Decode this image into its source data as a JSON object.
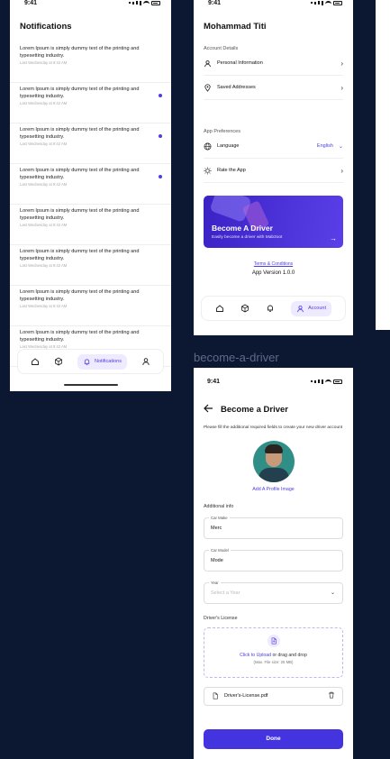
{
  "status_time": "9:41",
  "notifications": {
    "title": "Notifications",
    "items": [
      {
        "text": "Lorem Ipsum is simply dummy text of the printing and typesetting industry.",
        "time": "Last Wednesday at 9:42 AM",
        "unread": false
      },
      {
        "text": "Lorem Ipsum is simply dummy text of the printing and typesetting industry.",
        "time": "Last Wednesday at 9:42 AM",
        "unread": true
      },
      {
        "text": "Lorem Ipsum is simply dummy text of the printing and typesetting industry.",
        "time": "Last Wednesday at 9:42 AM",
        "unread": true
      },
      {
        "text": "Lorem Ipsum is simply dummy text of the printing and typesetting industry.",
        "time": "Last Wednesday at 9:42 AM",
        "unread": true
      },
      {
        "text": "Lorem Ipsum is simply dummy text of the printing and typesetting industry.",
        "time": "Last Wednesday at 9:42 AM",
        "unread": false
      },
      {
        "text": "Lorem Ipsum is simply dummy text of the printing and typesetting industry.",
        "time": "Last Wednesday at 9:42 AM",
        "unread": false
      },
      {
        "text": "Lorem Ipsum is simply dummy text of the printing and typesetting industry.",
        "time": "Last Wednesday at 9:42 AM",
        "unread": false
      },
      {
        "text": "Lorem Ipsum is simply dummy text of the printing and typesetting industry.",
        "time": "Last Wednesday at 9:42 AM",
        "unread": false
      }
    ],
    "nav_active_label": "Notifications"
  },
  "account": {
    "title": "Mohammad Titi",
    "account_details_label": "Account Details",
    "personal_info": "Personal Information",
    "saved_addresses": "Saved Addresses",
    "app_prefs_label": "App Preferences",
    "language": "Language",
    "language_value": "English",
    "rate_app": "Rate the App",
    "driver_card_title": "Become A Driver",
    "driver_card_sub": "Easily become a driver with Mab3oot",
    "terms": "Terms & Conditions",
    "version": "App Version 1.0.0",
    "nav_active_label": "Account"
  },
  "section_label": "become-a-driver",
  "driver": {
    "title": "Become a Driver",
    "intro": "Please fill the additional required fields to create your new driver account",
    "add_image": "Add A Profile Image",
    "additional_info": "Additional info",
    "car_make_label": "Car Make",
    "car_make_value": "Merc",
    "car_model_label": "Car Model",
    "car_model_value": "Mode",
    "year_label": "Year",
    "year_placeholder": "Select a Year",
    "license_label": "Driver's License",
    "upload_link": "Click to Upload",
    "upload_rest": " or drag and drop",
    "upload_sub": "(Max. File size: 25 MB)",
    "file_name": "Driver's-License.pdf",
    "done": "Done"
  },
  "colors": {
    "accent": "#4c3ee0",
    "background": "#0c1731"
  }
}
